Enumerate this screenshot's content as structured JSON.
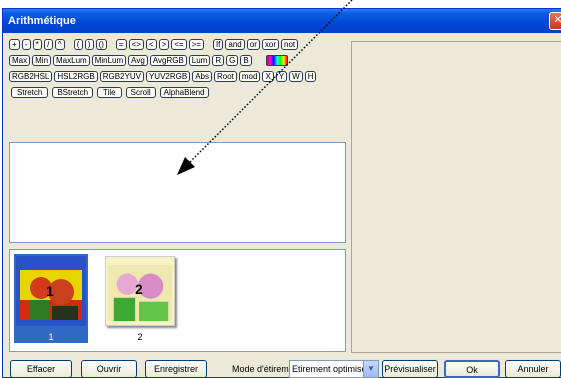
{
  "window": {
    "title": "Arithmétique",
    "close": "✕"
  },
  "toolbar": {
    "row1": [
      "+",
      "-",
      "*",
      "/",
      "^",
      "(",
      ")",
      "()",
      "=",
      "<>",
      "<",
      ">",
      "<=",
      ">=",
      "If",
      "and",
      "or",
      "xor",
      "not"
    ],
    "row2": [
      "Max",
      "Min",
      "MaxLum",
      "MinLum",
      "Avg",
      "AvgRGB",
      "Lum",
      "R",
      "G",
      "B"
    ],
    "row3": [
      "RGB2HSL",
      "HSL2RGB",
      "RGB2YUV",
      "YUV2RGB",
      "Abs",
      "Root",
      "mod",
      "X",
      "Y",
      "W",
      "H"
    ],
    "row4": [
      "Stretch",
      "BStretch",
      "Tile",
      "Scroll",
      "AlphaBlend"
    ]
  },
  "thumbnails": [
    {
      "caption": "1",
      "label": "1",
      "selected": true
    },
    {
      "caption": "2",
      "label": "2",
      "selected": false
    }
  ],
  "buttons": {
    "effacer": "Effacer",
    "ouvrir": "Ouvrir",
    "enregistrer": "Enregistrer",
    "previsualiser": "Prévisualiser",
    "ok": "Ok",
    "annuler": "Annuler"
  },
  "stretch_mode": {
    "label": "Mode d'étirement",
    "selected": "Etirement optimisé"
  },
  "colors": {
    "title_bar": "#0047d6",
    "dialog_bg": "#ece9d8",
    "selection": "#316ac5"
  },
  "icons": {
    "palette": "rainbow-palette-icon",
    "arrow": "dotted-arrow-annotation"
  }
}
